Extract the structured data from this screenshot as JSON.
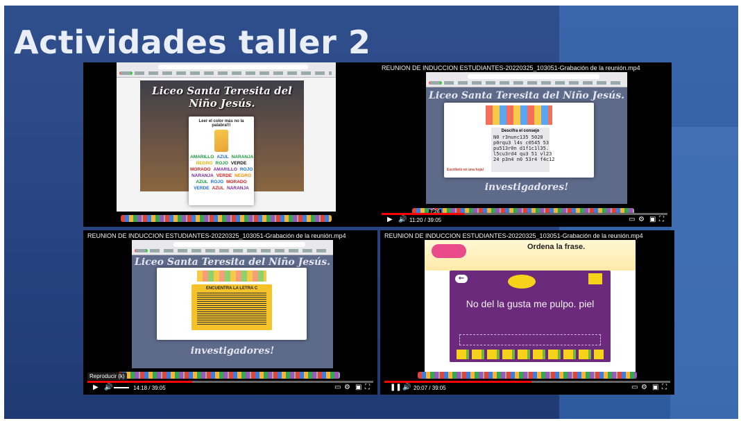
{
  "slide_title": "Actividades taller 2",
  "panel1": {
    "school_name": "Liceo Santa Teresita del Niño Jesús.",
    "modal_title": "Leer el color más no la palabra!!!",
    "word_rows": [
      [
        {
          "w": "AMARILLO",
          "c": "#1a9a3a"
        },
        {
          "w": "AZUL",
          "c": "#1a6fd0"
        },
        {
          "w": "NARANJA",
          "c": "#1a9a3a"
        }
      ],
      [
        {
          "w": "NEGRO",
          "c": "#e0b400"
        },
        {
          "w": "ROJO",
          "c": "#1a9a3a"
        },
        {
          "w": "VERDE",
          "c": "#111"
        }
      ],
      [
        {
          "w": "MORADO",
          "c": "#d42020"
        },
        {
          "w": "AMARILLO",
          "c": "#7a2aa0"
        },
        {
          "w": "ROJO",
          "c": "#1a6fd0"
        }
      ],
      [
        {
          "w": "NARANJA",
          "c": "#7a2aa0"
        },
        {
          "w": "VERDE",
          "c": "#d42020"
        },
        {
          "w": "NEGRO",
          "c": "#f08a00"
        }
      ],
      [
        {
          "w": "AZUL",
          "c": "#1a9a3a"
        },
        {
          "w": "ROJO",
          "c": "#1a6fd0"
        },
        {
          "w": "MORADO",
          "c": "#d42020"
        }
      ],
      [
        {
          "w": "VERDE",
          "c": "#1a6fd0"
        },
        {
          "w": "AZUL",
          "c": "#d42020"
        },
        {
          "w": "NARANJA",
          "c": "#7a2aa0"
        }
      ]
    ]
  },
  "panel2": {
    "rec_title": "REUNION DE INDUCCION ESTUDIANTES-20220325_103051-Grabación de la reunión.mp4",
    "school_name": "Liceo Santa Teresita del Niño Jesús.",
    "code_title": "Descifra el consejo",
    "code_text": "N0 r3nunc135 5020\np0rqu3 l4s c0545 53\npu513r0n d1f1c1l35.\nl5cu3rd4 qu3 51 vl23\n24 p3n4 n0 53r4 f4c12",
    "hint": "Escríbelo en una hoja!",
    "banner": "investigadores!",
    "chip": "7:26",
    "time": "11:20 / 39:05"
  },
  "panel3": {
    "rec_title": "REUNION DE INDUCCION ESTUDIANTES-20220325_103051-Grabación de la reunión.mp4",
    "school_name": "Liceo Santa Teresita del Niño Jesús.",
    "card_title": "ENCUENTRA LA LETRA C",
    "banner": "investigadores!",
    "tooltip": "Reproducir (k)",
    "time": "14:18 / 39:05"
  },
  "panel4": {
    "rec_title": "REUNION DE INDUCCION ESTUDIANTES-20220325_103051-Grabación de la reunión.mp4",
    "header": "Ordena la frase.",
    "sentence": "No del la gusta me pulpo. piel",
    "time": "20:07 / 39:05"
  },
  "progress": {
    "panel2": 0.29,
    "panel3": 0.366,
    "panel4": 0.515
  }
}
